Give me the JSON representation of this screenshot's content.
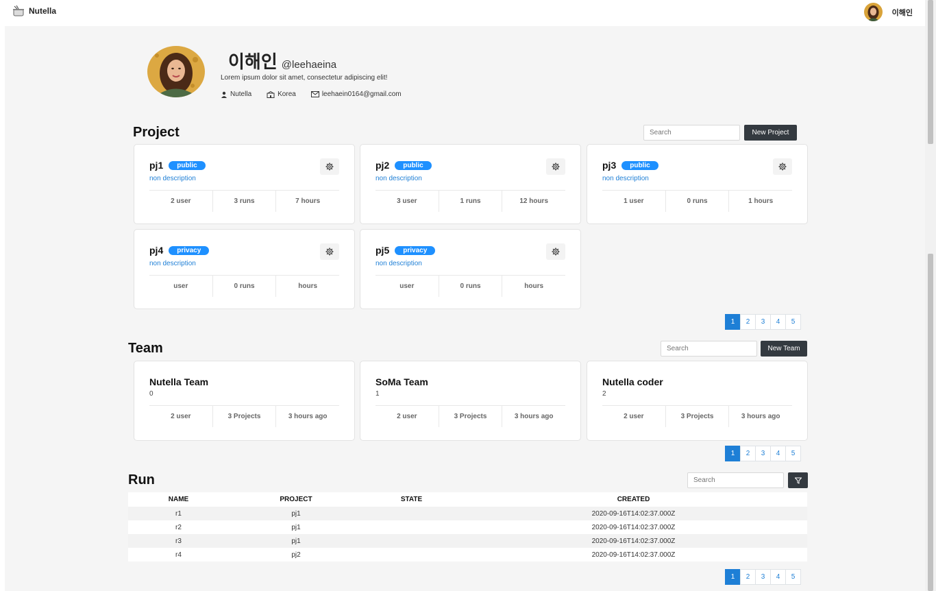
{
  "app": {
    "title": "Nutella"
  },
  "topbar": {
    "username": "이해인"
  },
  "profile": {
    "name": "이해인",
    "handle": "@leehaeina",
    "bio": "Lorem ipsum dolor sit amet, consectetur adipiscing elit!",
    "org": "Nutella",
    "location": "Korea",
    "email": "leehaein0164@gmail.com"
  },
  "project": {
    "title": "Project",
    "search_placeholder": "Search",
    "new_button": "New Project",
    "cards": [
      {
        "name": "pj1",
        "badge": "public",
        "desc": "non description",
        "stats": [
          "2 user",
          "3 runs",
          "7 hours"
        ]
      },
      {
        "name": "pj2",
        "badge": "public",
        "desc": "non description",
        "stats": [
          "3 user",
          "1 runs",
          "12 hours"
        ]
      },
      {
        "name": "pj3",
        "badge": "public",
        "desc": "non description",
        "stats": [
          "1 user",
          "0 runs",
          "1 hours"
        ]
      },
      {
        "name": "pj4",
        "badge": "privacy",
        "desc": "non description",
        "stats": [
          "user",
          "0 runs",
          "hours"
        ]
      },
      {
        "name": "pj5",
        "badge": "privacy",
        "desc": "non description",
        "stats": [
          "user",
          "0 runs",
          "hours"
        ]
      }
    ]
  },
  "team": {
    "title": "Team",
    "search_placeholder": "Search",
    "new_button": "New Team",
    "cards": [
      {
        "name": "Nutella Team",
        "num": "0",
        "stats": [
          "2 user",
          "3 Projects",
          "3 hours ago"
        ]
      },
      {
        "name": "SoMa Team",
        "num": "1",
        "stats": [
          "2 user",
          "3 Projects",
          "3 hours ago"
        ]
      },
      {
        "name": "Nutella coder",
        "num": "2",
        "stats": [
          "2 user",
          "3 Projects",
          "3 hours ago"
        ]
      }
    ]
  },
  "run": {
    "title": "Run",
    "search_placeholder": "Search",
    "columns": [
      "NAME",
      "PROJECT",
      "STATE",
      "CREATED"
    ],
    "rows": [
      [
        "r1",
        "pj1",
        "",
        "2020-09-16T14:02:37.000Z"
      ],
      [
        "r2",
        "pj1",
        "",
        "2020-09-16T14:02:37.000Z"
      ],
      [
        "r3",
        "pj1",
        "",
        "2020-09-16T14:02:37.000Z"
      ],
      [
        "r4",
        "pj2",
        "",
        "2020-09-16T14:02:37.000Z"
      ]
    ]
  },
  "pagination": {
    "pages": [
      "1",
      "2",
      "3",
      "4",
      "5"
    ],
    "active": "1"
  },
  "colors": {
    "accent": "#1e7fd6",
    "badge": "#1e90ff",
    "dark_button": "#343a40",
    "background": "#f5f5f5"
  },
  "icons": {
    "logo": "pot-icon",
    "settings": "gear-icon",
    "user": "person-icon",
    "location": "building-icon",
    "email": "mail-icon",
    "filter": "filter-icon"
  }
}
